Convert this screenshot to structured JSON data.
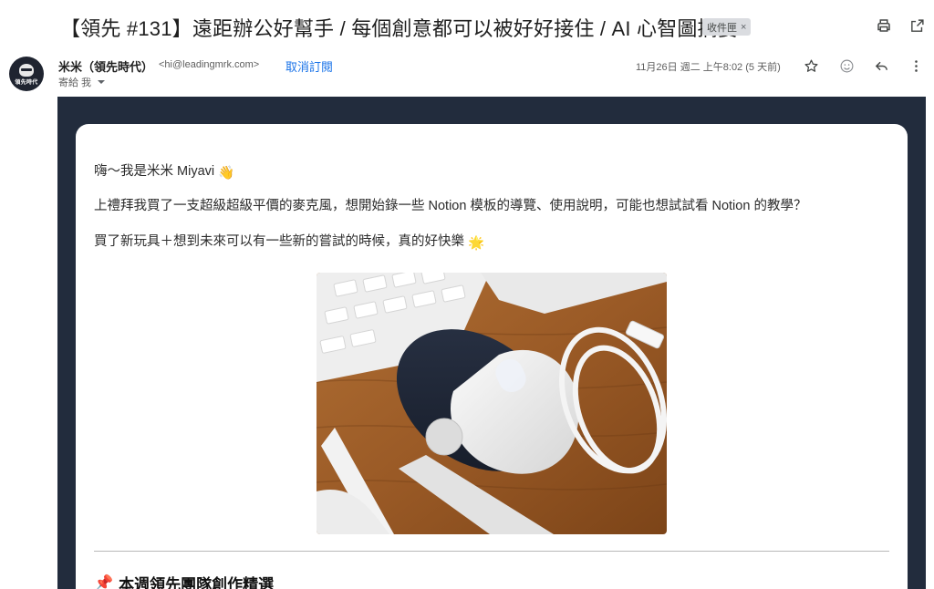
{
  "email": {
    "subject": "【領先 #131】遠距辦公好幫手 / 每個創意都可以被好好接住 / AI 心智圖摘要",
    "label": "收件匣",
    "label_close": "×",
    "sender_name": "米米（領先時代）",
    "sender_email": "<hi@leadingmrk.com>",
    "unsubscribe": "取消訂閱",
    "to_me": "寄給 我",
    "date": "11月26日 週二 上午8:02 (5 天前)",
    "avatar_text": "領先時代"
  },
  "icons": {
    "print": "print-icon",
    "open_new_window": "open-in-new-window-icon",
    "star": "star-icon",
    "emoji": "emoji-icon",
    "reply": "reply-icon",
    "more": "more-vert-icon"
  },
  "body": {
    "greeting": "嗨～我是米米 Miyavi",
    "greeting_emoji": "👋",
    "paragraph1": "上禮拜我買了一支超級超級平價的麥克風，想開始錄一些 Notion 模板的導覽、使用說明，可能也想試試看 Notion 的教學？",
    "paragraph2": "買了新玩具＋想到未來可以有一些新的嘗試的時候，真的好快樂",
    "paragraph2_emoji": "🌟",
    "section_title": "本週領先團隊創作精選",
    "section_emoji": "📌"
  },
  "colors": {
    "frame_bg": "#222c3d",
    "link": "#1a73e8",
    "chip_bg": "#dadce0"
  }
}
